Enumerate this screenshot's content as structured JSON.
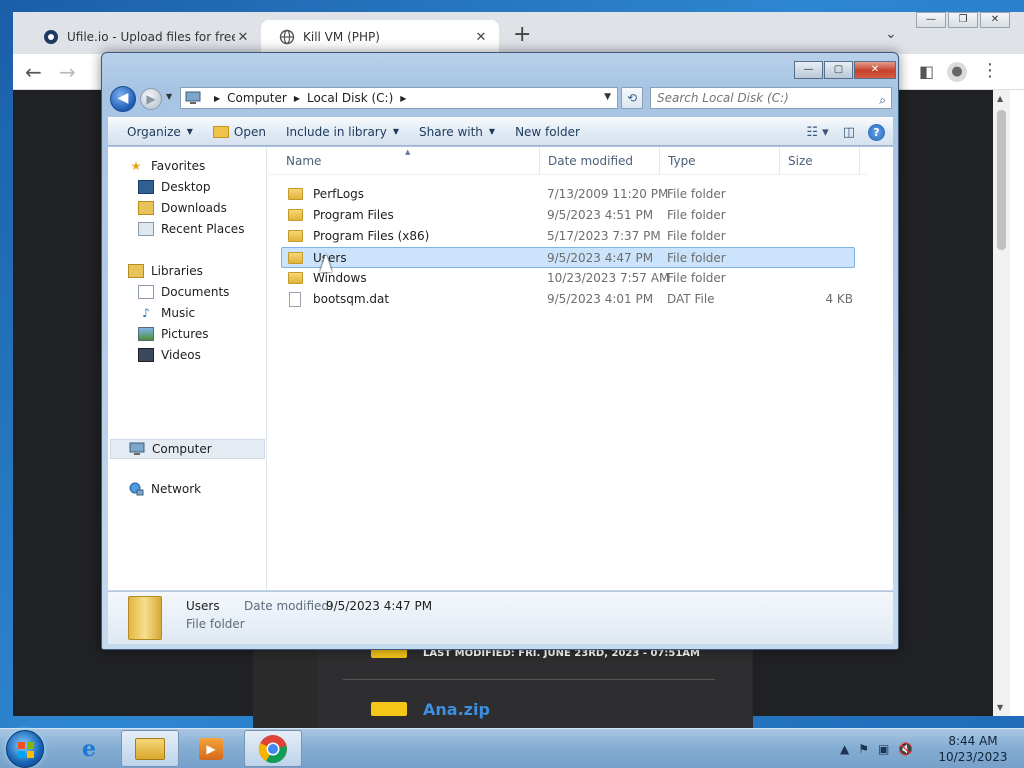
{
  "browser": {
    "tabs": [
      {
        "title": "Ufile.io - Upload files for free & s"
      },
      {
        "title": "Kill VM (PHP)"
      }
    ],
    "new_tab": "+",
    "tab_close": "✕",
    "window_controls": [
      "—",
      "❐",
      "✕"
    ]
  },
  "web_page": {
    "last_modified": "LAST MODIFIED: FRI. JUNE 23RD, 2023 - 07:51AM",
    "file_name": "Ana.zip"
  },
  "explorer": {
    "window_controls": {
      "minimize": "—",
      "maximize": "▢",
      "close": "✕"
    },
    "breadcrumb": [
      "Computer",
      "Local Disk (C:)"
    ],
    "search_placeholder": "Search Local Disk (C:)",
    "commands": {
      "organize": "Organize",
      "open": "Open",
      "include_in_library": "Include in library",
      "share_with": "Share with",
      "new_folder": "New folder"
    },
    "nav": {
      "favorites": "Favorites",
      "favorites_items": [
        "Desktop",
        "Downloads",
        "Recent Places"
      ],
      "libraries": "Libraries",
      "libraries_items": [
        "Documents",
        "Music",
        "Pictures",
        "Videos"
      ],
      "computer": "Computer",
      "network": "Network"
    },
    "columns": {
      "name": "Name",
      "date": "Date modified",
      "type": "Type",
      "size": "Size"
    },
    "files": [
      {
        "name": "PerfLogs",
        "date": "7/13/2009 11:20 PM",
        "type": "File folder",
        "size": "",
        "kind": "folder"
      },
      {
        "name": "Program Files",
        "date": "9/5/2023 4:51 PM",
        "type": "File folder",
        "size": "",
        "kind": "folder"
      },
      {
        "name": "Program Files (x86)",
        "date": "5/17/2023 7:37 PM",
        "type": "File folder",
        "size": "",
        "kind": "folder"
      },
      {
        "name": "Users",
        "date": "9/5/2023 4:47 PM",
        "type": "File folder",
        "size": "",
        "kind": "folder",
        "selected": true
      },
      {
        "name": "Windows",
        "date": "10/23/2023 7:57 AM",
        "type": "File folder",
        "size": "",
        "kind": "folder"
      },
      {
        "name": "bootsqm.dat",
        "date": "9/5/2023 4:01 PM",
        "type": "DAT File",
        "size": "4 KB",
        "kind": "file"
      }
    ],
    "details": {
      "name": "Users",
      "type": "File folder",
      "date_label": "Date modified:",
      "date_value": "9/5/2023 4:47 PM"
    }
  },
  "taskbar": {
    "clock_time": "8:44 AM",
    "clock_date": "10/23/2023"
  },
  "colors": {
    "selection": "#cce4fb",
    "folder": "#e1b339",
    "taskbar": "#86aed4"
  }
}
